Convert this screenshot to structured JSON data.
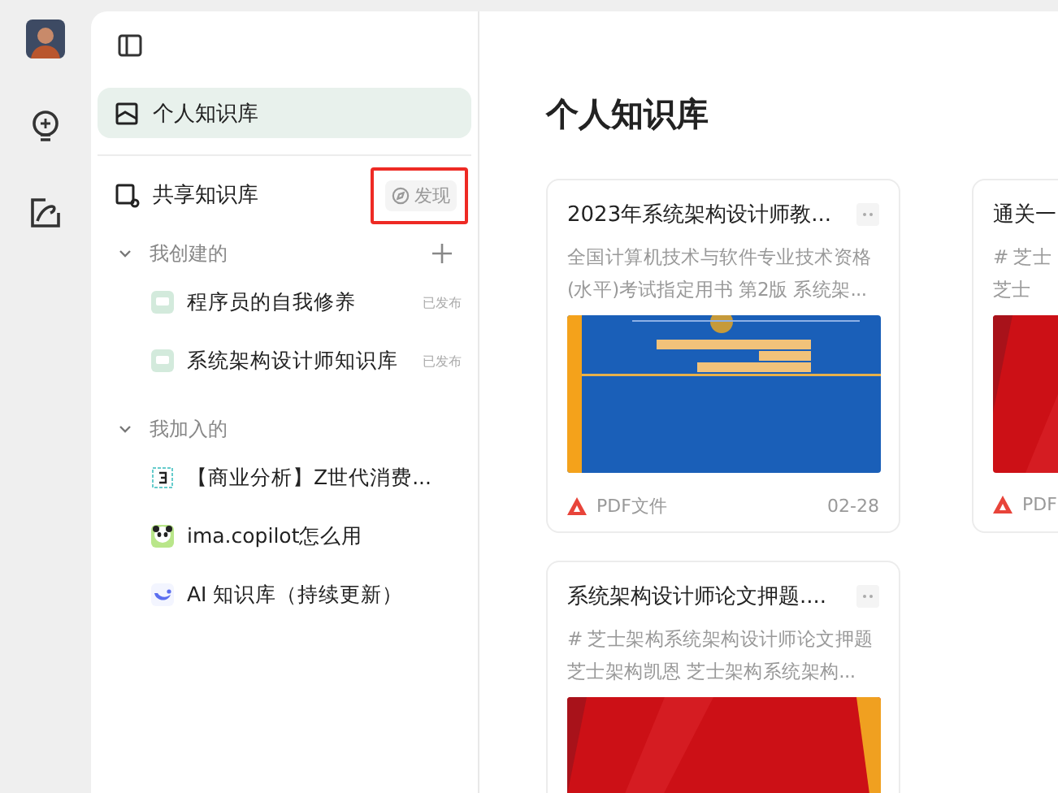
{
  "rail": {
    "items": [
      {
        "kind": "bulb"
      },
      {
        "kind": "edit"
      }
    ]
  },
  "sidebar": {
    "personal": {
      "label": "个人知识库",
      "selected": true
    },
    "shared": {
      "label": "共享知识库",
      "discover": "发现",
      "highlighted": true
    },
    "groups": [
      {
        "label": "我创建的",
        "expanded": true,
        "can_add": true,
        "items": [
          {
            "label": "程序员的自我修养",
            "kind": "book",
            "status": "已发布"
          },
          {
            "label": "系统架构设计师知识库",
            "kind": "book",
            "status": "已发布"
          }
        ]
      },
      {
        "label": "我加入的",
        "expanded": true,
        "can_add": false,
        "items": [
          {
            "label": "【商业分析】Z世代消费...",
            "kind": "chart"
          },
          {
            "label": "ima.copilot怎么用",
            "kind": "panda"
          },
          {
            "label": "AI 知识库（持续更新）",
            "kind": "whale"
          }
        ]
      }
    ]
  },
  "main": {
    "title": "个人知识库",
    "cards": [
      {
        "title": "2023年系统架构设计师教...",
        "desc_lines": [
          "全国计算机技术与软件专业技术资格",
          "(水平)考试指定用书 第2版 系统架..."
        ],
        "file_type": "PDF文件",
        "date": "02-28"
      },
      {
        "title": "通关一",
        "desc_lines": [
          "# 芝士",
          "芝士"
        ],
        "file_type": "PDF"
      },
      {
        "title": "系统架构设计师论文押题....",
        "desc_lines": [
          "# 芝士架构系统架构设计师论文押题",
          "芝士架构凯恩 芝士架构系统架构..."
        ]
      }
    ]
  }
}
